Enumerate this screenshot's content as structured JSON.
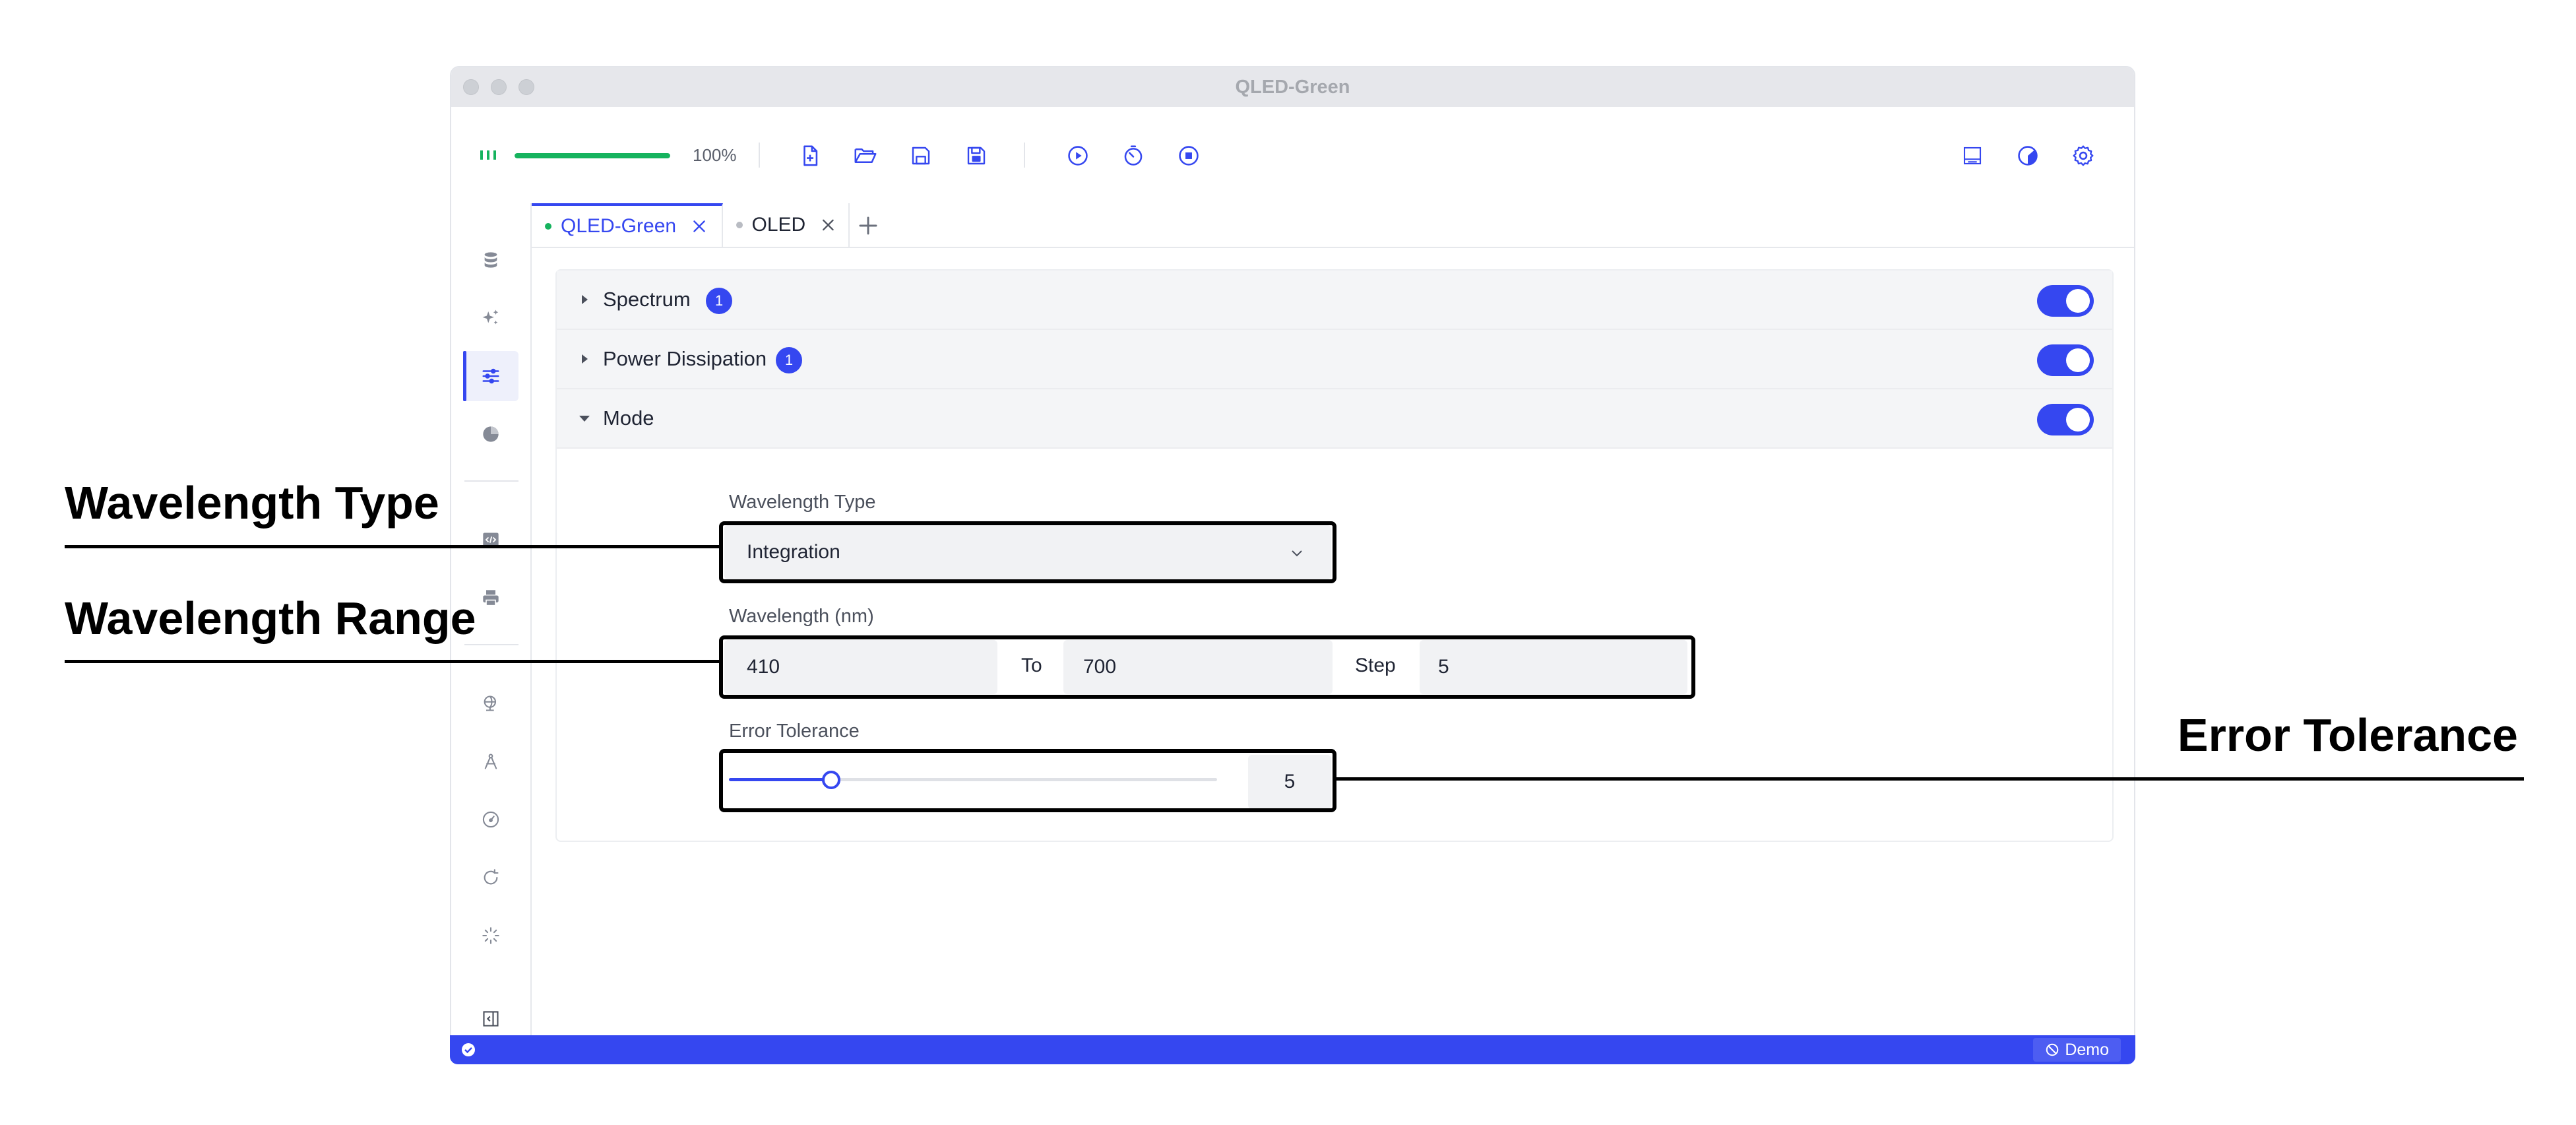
{
  "window": {
    "title": "QLED-Green"
  },
  "toolbar": {
    "progress_percent": 100,
    "progress_label": "100%",
    "buttons": [
      "new-file-icon",
      "open-folder-icon",
      "save-icon",
      "save-as-icon",
      "run-icon",
      "timer-icon",
      "stop-icon"
    ],
    "right_buttons": [
      "panel-icon",
      "theme-icon",
      "settings-icon"
    ]
  },
  "sidebar": {
    "items": [
      "database-icon",
      "sparkle-icon",
      "sliders-icon",
      "pie-icon",
      "code-icon",
      "print-icon",
      "globe-icon",
      "compass-icon",
      "gauge-icon",
      "refresh-icon",
      "loading-icon"
    ],
    "active": "sliders-icon"
  },
  "tabs": [
    {
      "label": "QLED-Green",
      "active": true,
      "dot_color": "#16b35e"
    },
    {
      "label": "OLED",
      "active": false,
      "dot_color": "#b9bcc3"
    }
  ],
  "sections": [
    {
      "title": "Spectrum",
      "badge": "1",
      "expanded": false,
      "enabled": true
    },
    {
      "title": "Power Dissipation",
      "badge": "1",
      "expanded": false,
      "enabled": true
    },
    {
      "title": "Mode",
      "badge": "",
      "expanded": true,
      "enabled": true
    }
  ],
  "mode": {
    "wavelength_type_label": "Wavelength Type",
    "wavelength_type_value": "Integration",
    "wavelength_label": "Wavelength (nm)",
    "from": "410",
    "to_label": "To",
    "to": "700",
    "step_label": "Step",
    "step": "5",
    "error_tolerance_label": "Error Tolerance",
    "error_tolerance_value": "5",
    "error_tolerance_fraction": 0.21
  },
  "statusbar": {
    "demo_label": "Demo"
  },
  "annotations": {
    "wavelength_type": "Wavelength Type",
    "wavelength_range": "Wavelength Range",
    "error_tolerance": "Error Tolerance"
  },
  "colors": {
    "accent": "#3547f0",
    "success": "#16b35e"
  }
}
